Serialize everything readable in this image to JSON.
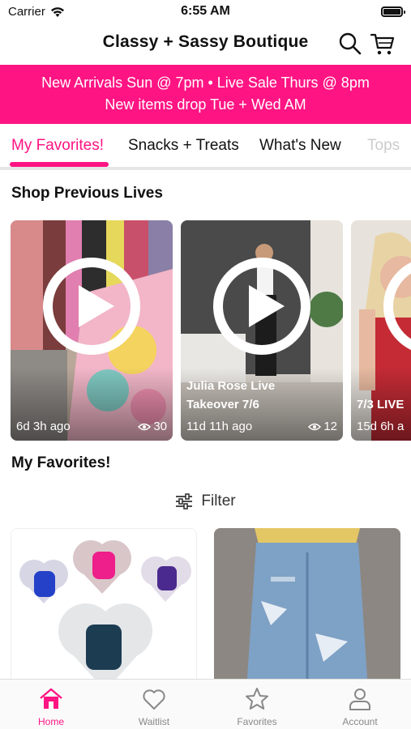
{
  "status": {
    "carrier": "Carrier",
    "time": "6:55 AM"
  },
  "header": {
    "title": "Classy + Sassy Boutique"
  },
  "banner": {
    "line1": "New Arrivals Sun @ 7pm • Live Sale Thurs @ 8pm",
    "line2": "New items drop Tue + Wed AM"
  },
  "tabs": [
    {
      "label": "My Favorites!",
      "active": true
    },
    {
      "label": "Snacks + Treats"
    },
    {
      "label": "What's New"
    },
    {
      "label": "Tops"
    }
  ],
  "sections": {
    "previous_lives": "Shop Previous Lives",
    "favorites": "My Favorites!"
  },
  "lives": [
    {
      "title": "",
      "ago": "6d 3h ago",
      "views": "30"
    },
    {
      "title_line1": "Julia Rose Live",
      "title_line2": "Takeover 7/6",
      "ago": "11d 11h ago",
      "views": "12"
    },
    {
      "title": "7/3 LIVE",
      "ago": "15d 6h a"
    }
  ],
  "filter": {
    "label": "Filter"
  },
  "nav": [
    {
      "label": "Home",
      "icon": "home-icon",
      "active": true
    },
    {
      "label": "Waitlist",
      "icon": "heart-icon"
    },
    {
      "label": "Favorites",
      "icon": "star-icon"
    },
    {
      "label": "Account",
      "icon": "user-icon"
    }
  ],
  "colors": {
    "accent": "#ff1483",
    "banner_text": "#ffffff",
    "tab_divider": "#e6e6e6"
  }
}
